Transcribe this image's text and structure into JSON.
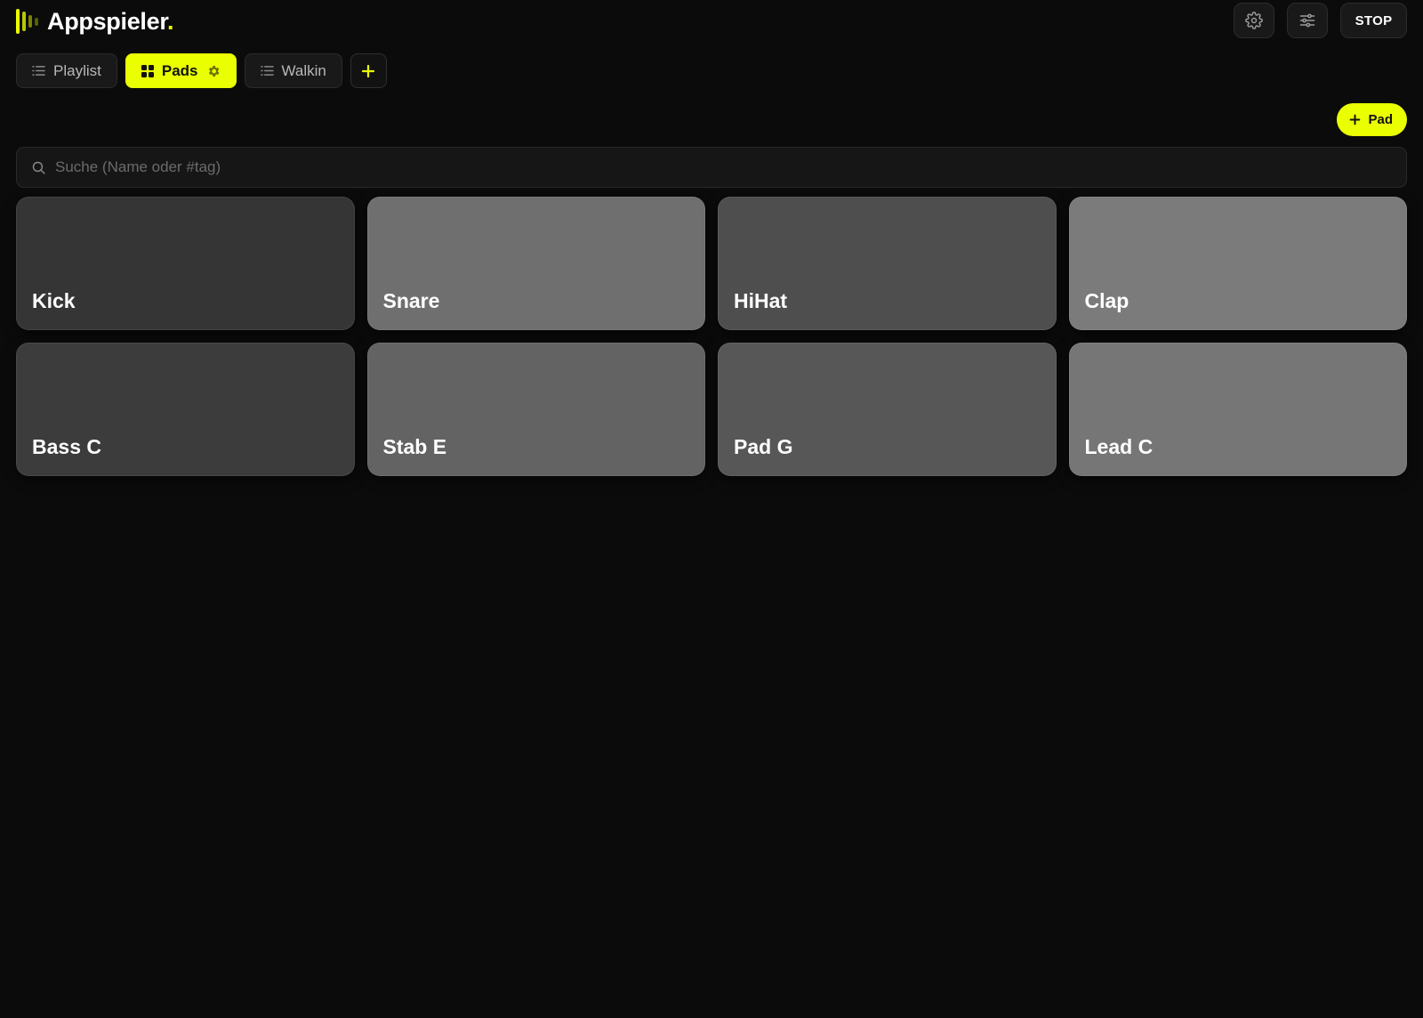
{
  "app": {
    "name": "Appspieler",
    "name_dot": ".",
    "accent": "#eaff00"
  },
  "header": {
    "settings_icon": "gear-icon",
    "mixer_icon": "sliders-icon",
    "stop_label": "STOP"
  },
  "tabs": [
    {
      "label": "Playlist",
      "icon": "list-icon",
      "active": false
    },
    {
      "label": "Pads",
      "icon": "grid-icon",
      "active": true,
      "settings_icon": "gear-icon"
    },
    {
      "label": "Walkin",
      "icon": "list-icon",
      "active": false
    }
  ],
  "add_tab_icon": "plus-icon",
  "toolbar": {
    "add_pad_label": "Pad",
    "add_pad_icon": "plus-icon"
  },
  "search": {
    "placeholder": "Suche (Name oder #tag)",
    "value": ""
  },
  "pads": [
    {
      "label": "Kick",
      "color": "#353535"
    },
    {
      "label": "Snare",
      "color": "#6f6f6f"
    },
    {
      "label": "HiHat",
      "color": "#4e4e4e"
    },
    {
      "label": "Clap",
      "color": "#7b7b7b"
    },
    {
      "label": "Bass C",
      "color": "#3c3c3c"
    },
    {
      "label": "Stab E",
      "color": "#636363"
    },
    {
      "label": "Pad G",
      "color": "#575757"
    },
    {
      "label": "Lead C",
      "color": "#767676"
    }
  ]
}
